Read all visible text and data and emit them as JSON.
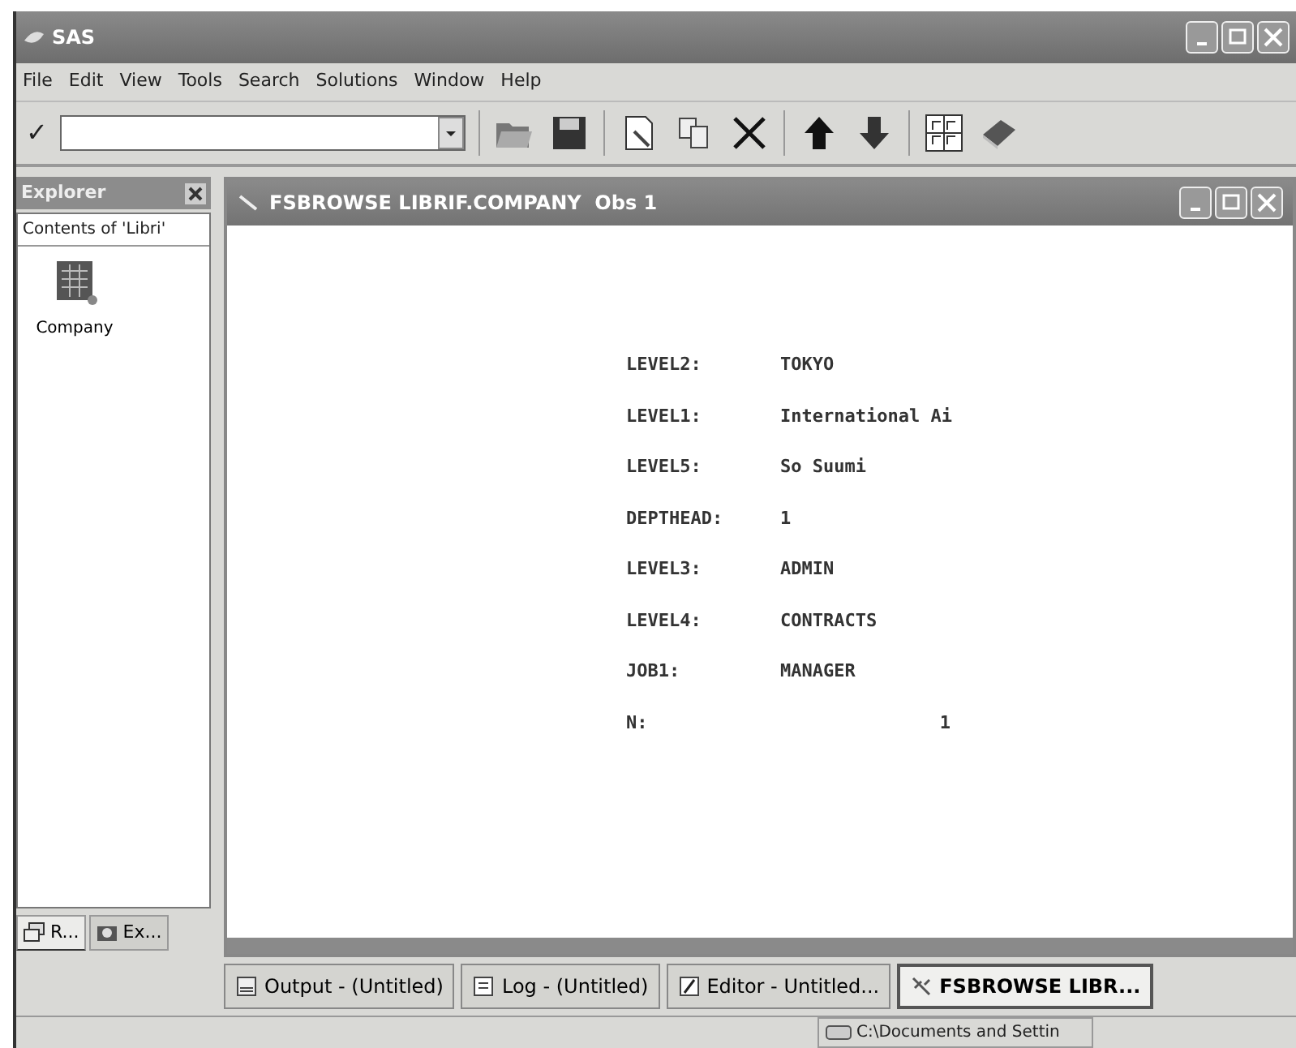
{
  "window": {
    "title": "SAS"
  },
  "menu": [
    "File",
    "Edit",
    "View",
    "Tools",
    "Search",
    "Solutions",
    "Window",
    "Help"
  ],
  "toolbar": {
    "check": "✓"
  },
  "explorer": {
    "title": "Explorer",
    "heading": "Contents of 'Libri'",
    "items": [
      {
        "label": "Company"
      }
    ],
    "tabs": [
      {
        "label": "R...",
        "selected": true
      },
      {
        "label": "Ex...",
        "selected": false
      }
    ]
  },
  "browse_window": {
    "title": "FSBROWSE LIBRIF.COMPANY  Obs 1",
    "fields": [
      {
        "label": "LEVEL2:",
        "value": "TOKYO",
        "kind": "text"
      },
      {
        "label": "LEVEL1:",
        "value": "International Ai",
        "kind": "text"
      },
      {
        "label": "LEVEL5:",
        "value": "So Suumi",
        "kind": "text"
      },
      {
        "label": "DEPTHEAD:",
        "value": "1",
        "kind": "text"
      },
      {
        "label": "LEVEL3:",
        "value": "ADMIN",
        "kind": "text"
      },
      {
        "label": "LEVEL4:",
        "value": "CONTRACTS",
        "kind": "text"
      },
      {
        "label": "JOB1:",
        "value": "MANAGER",
        "kind": "text"
      },
      {
        "label": "N:",
        "value": "1",
        "kind": "numeric"
      }
    ]
  },
  "taskbar": [
    {
      "label": "Output - (Untitled)",
      "selected": false
    },
    {
      "label": "Log - (Untitled)",
      "selected": false
    },
    {
      "label": "Editor - Untitled...",
      "selected": false
    },
    {
      "label": "FSBROWSE LIBR...",
      "selected": true
    }
  ],
  "status_bar": {
    "path": "C:\\Documents and Settin"
  }
}
